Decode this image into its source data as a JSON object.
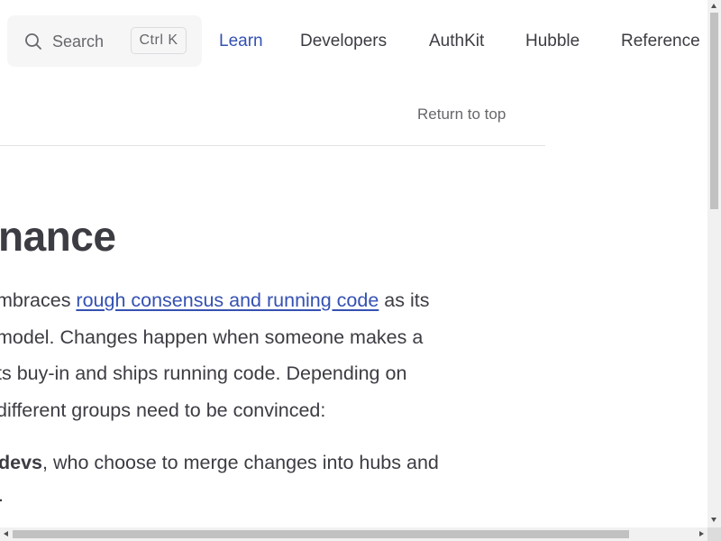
{
  "nav": {
    "search_label": "Search",
    "search_shortcut": "Ctrl K",
    "links": [
      "Learn",
      "Developers",
      "AuthKit",
      "Hubble",
      "Reference"
    ],
    "active_link": "Learn",
    "accent_color": "#3451b2"
  },
  "outline": {
    "return_to_top": "Return to top"
  },
  "content": {
    "heading": "nance",
    "paragraph_lines": [
      {
        "pre": "mbraces ",
        "link": "rough consensus and running code",
        "post": " as its"
      },
      {
        "text": " model. Changes happen when someone makes a"
      },
      {
        "text": "ts buy-in and ships running code. Depending on"
      },
      {
        "text": " different groups need to be convinced:"
      }
    ],
    "list_item": {
      "bold": "devs",
      "line1_rest": ", who choose to merge changes into hubs and",
      "line2": "."
    }
  },
  "icons": {
    "search": "search-icon",
    "scroll_up": "triangle-up-icon",
    "scroll_down": "triangle-down-icon",
    "scroll_left": "triangle-left-icon",
    "scroll_right": "triangle-right-icon"
  }
}
